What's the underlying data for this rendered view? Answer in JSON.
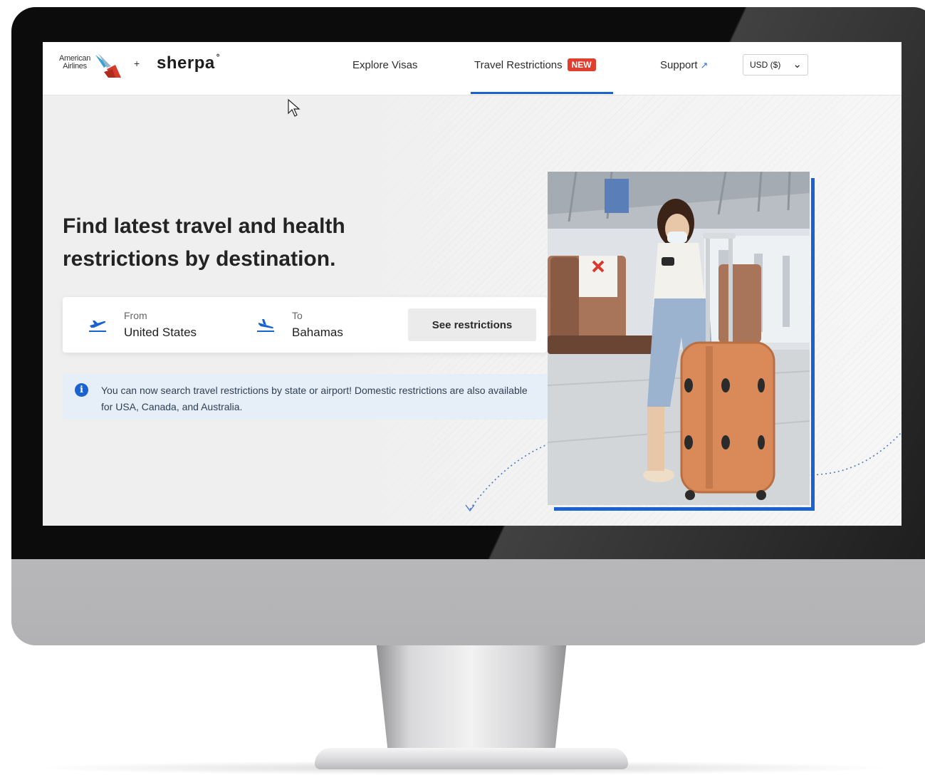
{
  "nav": {
    "partner_logo_text": "American Airlines",
    "plus": "+",
    "brand": "sherpa",
    "brand_mark": "°",
    "links": {
      "explore_visas": "Explore Visas",
      "travel_restrictions": "Travel Restrictions",
      "new_badge": "NEW",
      "support": "Support",
      "support_icon": "external-link-icon"
    },
    "currency": "USD ($)"
  },
  "hero": {
    "headline": "Find latest travel and health restrictions by destination.",
    "search": {
      "from_label": "From",
      "from_value": "United States",
      "to_label": "To",
      "to_value": "Bahamas",
      "button_label": "See restrictions"
    },
    "info_banner": {
      "icon": "info-icon",
      "text": "You can now search travel restrictions by state or airport! Domestic restrictions are also available for USA, Canada, and Australia."
    },
    "image": "woman-with-mask-and-suitcase-in-airport"
  },
  "colors": {
    "accent_blue": "#1a62d0",
    "badge_red": "#e03f2f",
    "banner_bg": "#e6eef7"
  }
}
